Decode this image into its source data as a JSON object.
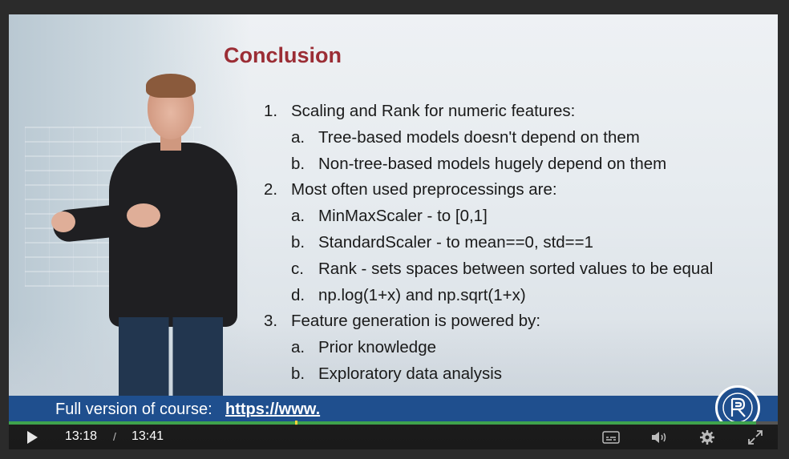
{
  "slide": {
    "title": "Conclusion",
    "items": [
      {
        "num": "1.",
        "text": "Scaling and Rank for numeric features:",
        "level": 1
      },
      {
        "num": "a.",
        "text": "Tree-based models doesn't depend on them",
        "level": 2
      },
      {
        "num": "b.",
        "text": "Non-tree-based models hugely depend on them",
        "level": 2
      },
      {
        "num": "2.",
        "text": "Most often used preprocessings are:",
        "level": 1
      },
      {
        "num": "a.",
        "text": "MinMaxScaler - to [0,1]",
        "level": 2
      },
      {
        "num": "b.",
        "text": "StandardScaler - to mean==0, std==1",
        "level": 2
      },
      {
        "num": "c.",
        "text": "Rank - sets spaces between sorted values to be equal",
        "level": 2
      },
      {
        "num": "d.",
        "text": "np.log(1+x) and np.sqrt(1+x)",
        "level": 2
      },
      {
        "num": "3.",
        "text": "Feature generation is powered by:",
        "level": 1
      },
      {
        "num": "a.",
        "text": "Prior knowledge",
        "level": 2
      },
      {
        "num": "b.",
        "text": "Exploratory data analysis",
        "level": 2
      }
    ]
  },
  "banner": {
    "label": "Full version of course:",
    "link": "https://www."
  },
  "player": {
    "current_time": "13:18",
    "separator": "/",
    "duration": "13:41",
    "progress_fraction": 0.972,
    "buffer_marker_fraction": 0.372,
    "icons": {
      "play": "play-icon",
      "captions": "captions-icon",
      "volume": "volume-icon",
      "settings": "gear-icon",
      "fullscreen": "fullscreen-icon",
      "logo": "hse-logo"
    },
    "colors": {
      "progress": "#3fa34d",
      "banner": "#1f4f8e",
      "title": "#9b2d35"
    }
  }
}
